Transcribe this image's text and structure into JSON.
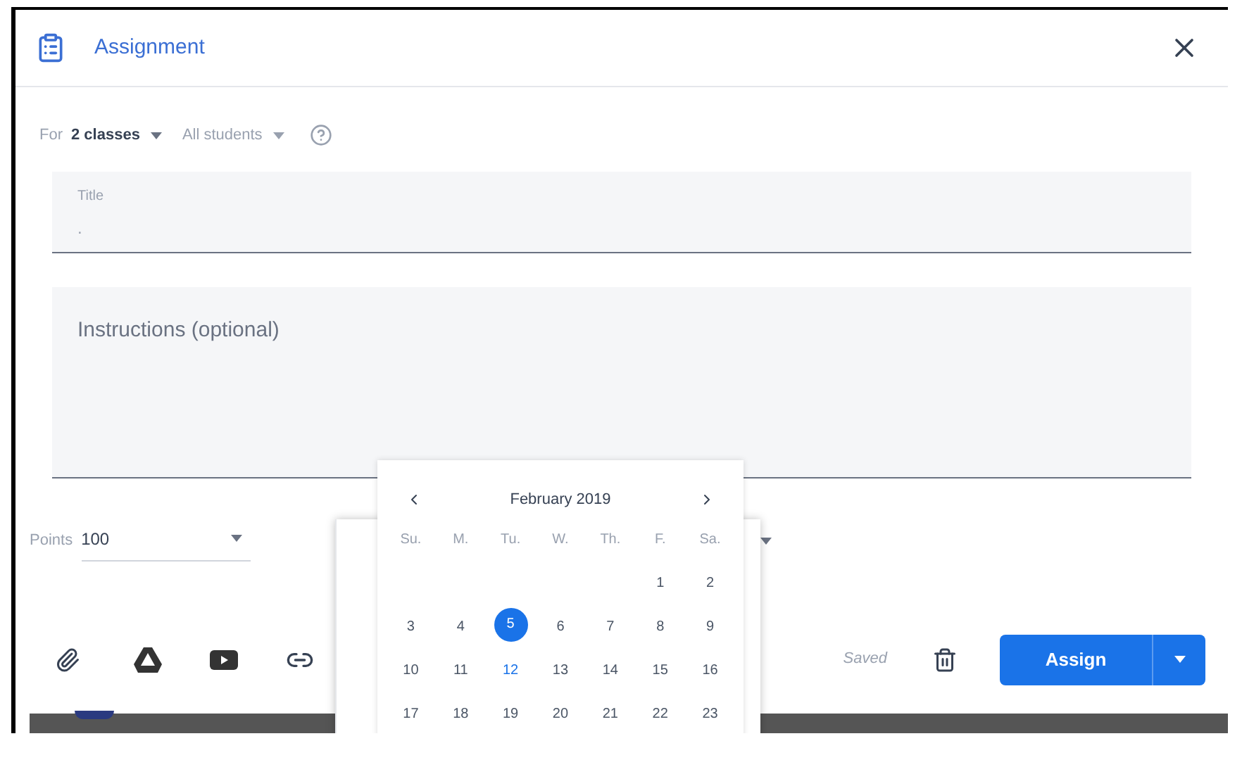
{
  "dialog": {
    "title": "Assignment"
  },
  "audience": {
    "prefix": "For",
    "classes": "2 classes",
    "students": "All students"
  },
  "title_field": {
    "placeholder": "Title",
    "value": "."
  },
  "instructions_field": {
    "placeholder": "Instructions (optional)"
  },
  "points": {
    "label": "Points",
    "value": "100"
  },
  "calendar": {
    "month": "February 2019",
    "weekdays": [
      "Su.",
      "M.",
      "Tu.",
      "W.",
      "Th.",
      "F.",
      "Sa."
    ],
    "weeks": [
      [
        {
          "day": "1",
          "selected": false,
          "today": false
        },
        {
          "day": "2",
          "selected": false,
          "today": false
        }
      ],
      [
        {
          "day": "3",
          "selected": false,
          "today": false
        },
        {
          "day": "4",
          "selected": false,
          "today": false
        },
        {
          "day": "5",
          "selected": true,
          "today": false
        },
        {
          "day": "6",
          "selected": false,
          "today": false
        },
        {
          "day": "7",
          "selected": false,
          "today": false
        },
        {
          "day": "8",
          "selected": false,
          "today": false
        },
        {
          "day": "9",
          "selected": false,
          "today": false
        }
      ],
      [
        {
          "day": "10",
          "selected": false,
          "today": false
        },
        {
          "day": "11",
          "selected": false,
          "today": false
        },
        {
          "day": "12",
          "selected": false,
          "today": true
        },
        {
          "day": "13",
          "selected": false,
          "today": false
        },
        {
          "day": "14",
          "selected": false,
          "today": false
        },
        {
          "day": "15",
          "selected": false,
          "today": false
        },
        {
          "day": "16",
          "selected": false,
          "today": false
        }
      ],
      [
        {
          "day": "17",
          "selected": false,
          "today": false
        },
        {
          "day": "18",
          "selected": false,
          "today": false
        },
        {
          "day": "19",
          "selected": false,
          "today": false
        },
        {
          "day": "20",
          "selected": false,
          "today": false
        },
        {
          "day": "21",
          "selected": false,
          "today": false
        },
        {
          "day": "22",
          "selected": false,
          "today": false
        },
        {
          "day": "23",
          "selected": false,
          "today": false
        }
      ]
    ]
  },
  "footer": {
    "status": "Saved",
    "primary_button": "Assign"
  }
}
